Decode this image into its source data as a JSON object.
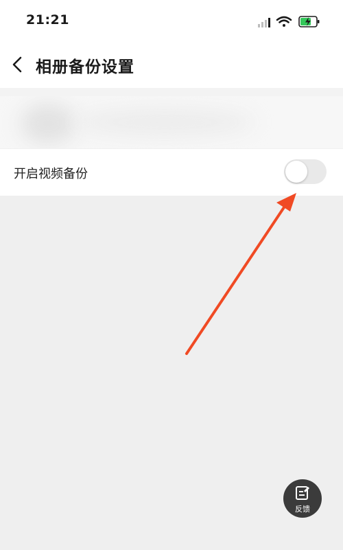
{
  "status_bar": {
    "time": "21:21",
    "signal_icon": "cellular-signal-icon",
    "wifi_icon": "wifi-icon",
    "battery_icon": "battery-charging-icon",
    "battery_color": "#33c759"
  },
  "nav": {
    "back_icon": "chevron-left-icon",
    "title": "相册备份设置"
  },
  "settings": {
    "video_backup": {
      "label": "开启视频备份",
      "enabled": false
    }
  },
  "annotation": {
    "arrow_color": "#f04a24"
  },
  "feedback": {
    "icon": "edit-note-icon",
    "label": "反馈"
  }
}
